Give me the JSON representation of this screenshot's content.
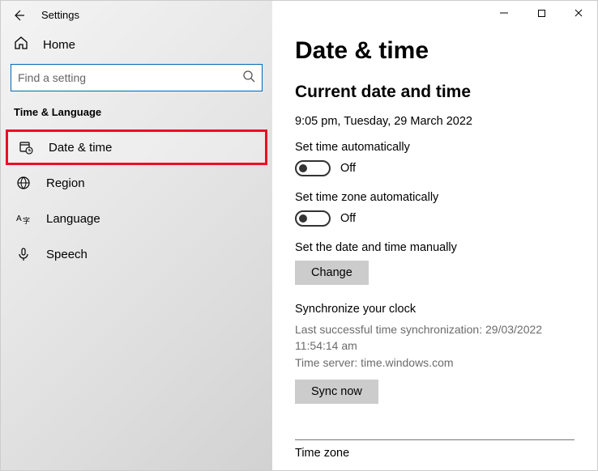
{
  "titlebar": {
    "title": "Settings"
  },
  "sidebar": {
    "home": "Home",
    "search_placeholder": "Find a setting",
    "section": "Time & Language",
    "items": [
      {
        "label": "Date & time"
      },
      {
        "label": "Region"
      },
      {
        "label": "Language"
      },
      {
        "label": "Speech"
      }
    ]
  },
  "page": {
    "heading": "Date & time",
    "sub": "Current date and time",
    "now": "9:05 pm, Tuesday, 29 March 2022",
    "auto_time_label": "Set time automatically",
    "auto_time_state": "Off",
    "auto_tz_label": "Set time zone automatically",
    "auto_tz_state": "Off",
    "manual_label": "Set the date and time manually",
    "change_btn": "Change",
    "sync_heading": "Synchronize your clock",
    "sync_line1": "Last successful time synchronization: 29/03/2022 11:54:14 am",
    "sync_line2": "Time server: time.windows.com",
    "sync_btn": "Sync now",
    "tz_heading": "Time zone"
  }
}
